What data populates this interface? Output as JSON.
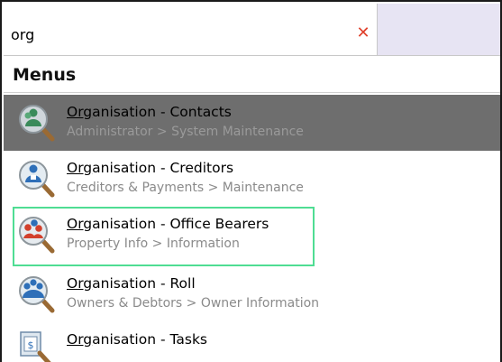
{
  "search": {
    "value": "org",
    "clear_symbol": "✕"
  },
  "section": {
    "title": "Menus"
  },
  "results": [
    {
      "match": "Org",
      "rest": "anisation - Contacts",
      "path": "Administrator > System Maintenance",
      "icon": "contacts-search-icon",
      "state": "selected"
    },
    {
      "match": "Org",
      "rest": "anisation - Creditors",
      "path": "Creditors & Payments > Maintenance",
      "icon": "creditors-search-icon",
      "state": "normal"
    },
    {
      "match": "Org",
      "rest": "anisation - Office Bearers",
      "path": "Property Info > Information",
      "icon": "office-bearers-search-icon",
      "state": "focused"
    },
    {
      "match": "Org",
      "rest": "anisation - Roll",
      "path": "Owners & Debtors > Owner Information",
      "icon": "roll-search-icon",
      "state": "normal"
    },
    {
      "match": "Org",
      "rest": "anisation - Tasks",
      "path": "",
      "icon": "tasks-search-icon",
      "state": "normal"
    }
  ],
  "colors": {
    "selected_bg": "#6e6e6e",
    "focus_border": "#4fdd93",
    "clear_icon": "#e0412c",
    "search_extra_bg": "#e7e4f3"
  }
}
